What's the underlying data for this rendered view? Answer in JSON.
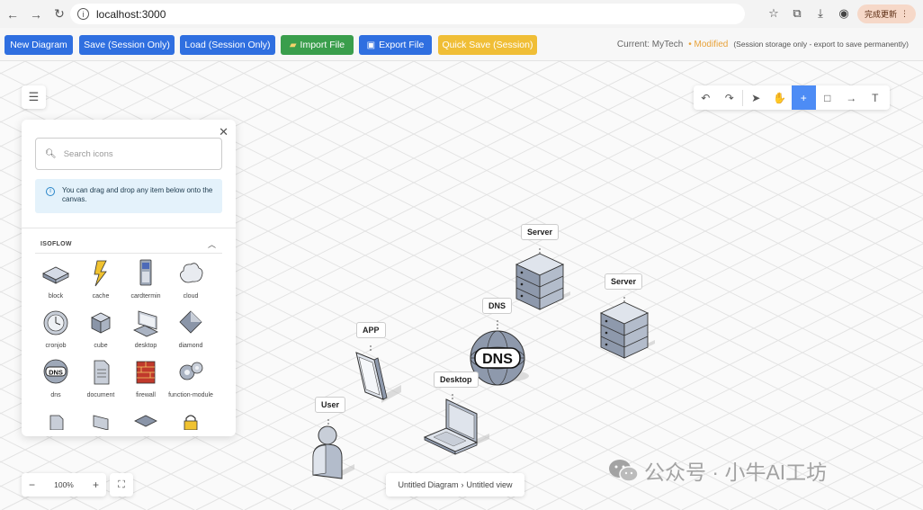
{
  "browser": {
    "url": "localhost:3000",
    "update_label": "完成更新"
  },
  "toolbar": {
    "new_diagram": "New Diagram",
    "save_session": "Save (Session Only)",
    "load_session": "Load (Session Only)",
    "import_file": "Import File",
    "export_file": "Export File",
    "quick_save": "Quick Save (Session)",
    "current": "Current: MyTech",
    "modified": "• Modified",
    "hint": "(Session storage only - export to save permanently)"
  },
  "panel": {
    "search_placeholder": "Search icons",
    "info_text": "You can drag and drop any item below onto the canvas.",
    "section_title": "ISOFLOW",
    "icons": [
      {
        "label": "block",
        "icon": "block-icon"
      },
      {
        "label": "cache",
        "icon": "cache-icon"
      },
      {
        "label": "cardtermin",
        "icon": "card-terminal-icon"
      },
      {
        "label": "cloud",
        "icon": "cloud-icon"
      },
      {
        "label": "cronjob",
        "icon": "cronjob-icon"
      },
      {
        "label": "cube",
        "icon": "cube-icon"
      },
      {
        "label": "desktop",
        "icon": "desktop-icon"
      },
      {
        "label": "diamond",
        "icon": "diamond-icon"
      },
      {
        "label": "dns",
        "icon": "dns-icon"
      },
      {
        "label": "document",
        "icon": "document-icon"
      },
      {
        "label": "firewall",
        "icon": "firewall-icon"
      },
      {
        "label": "function-module",
        "icon": "function-module-icon"
      }
    ]
  },
  "nodes": {
    "server1": "Server",
    "server2": "Server",
    "dns": "DNS",
    "dns_text": "DNS",
    "app": "APP",
    "desktop": "Desktop",
    "user": "User"
  },
  "zoom": {
    "level": "100%"
  },
  "breadcrumb": {
    "diagram": "Untitled Diagram",
    "sep": "›",
    "view": "Untitled view"
  },
  "watermark": {
    "text": "公众号 · 小牛AI工坊"
  }
}
